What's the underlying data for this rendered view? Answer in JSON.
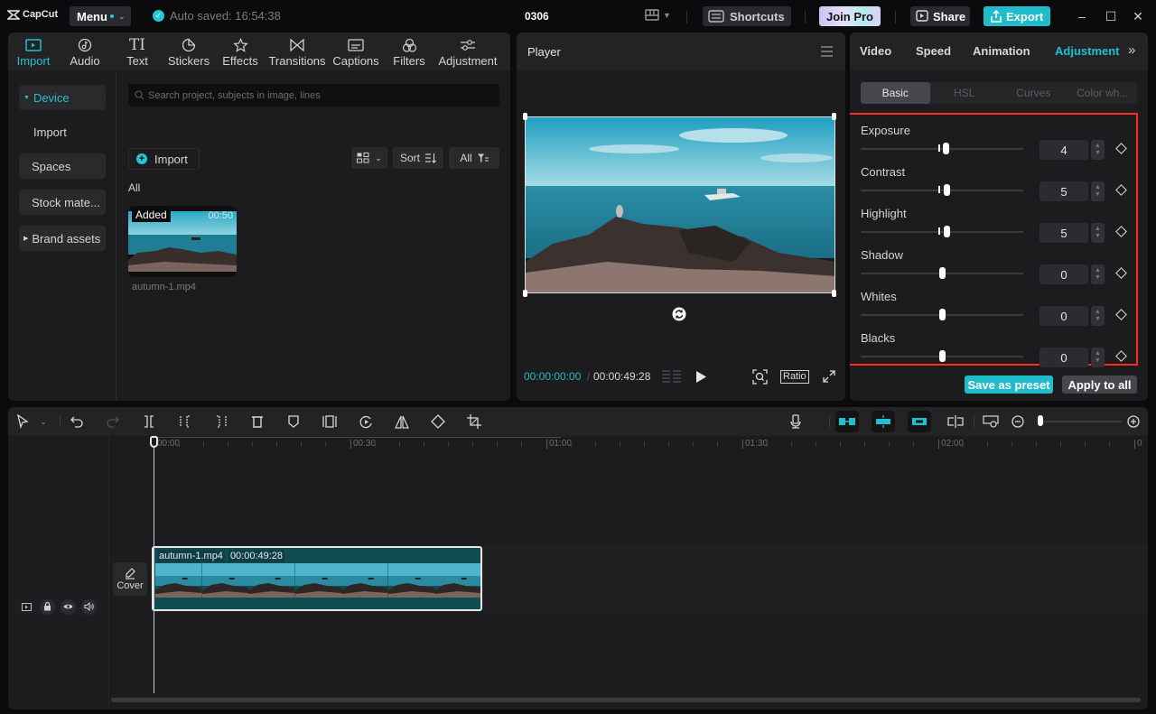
{
  "app": {
    "logo": "CapCut",
    "menu_label": "Menu",
    "autosave": "Auto saved: 16:54:38",
    "project_name": "0306",
    "shortcuts_label": "Shortcuts",
    "join_pro_label": "Join Pro",
    "share_label": "Share",
    "export_label": "Export",
    "accent_color": "#22c0cf"
  },
  "media": {
    "tabs": [
      {
        "label": "Import",
        "icon": "import-icon",
        "active": true
      },
      {
        "label": "Audio",
        "icon": "audio-icon"
      },
      {
        "label": "Text",
        "icon": "text-icon"
      },
      {
        "label": "Stickers",
        "icon": "stickers-icon"
      },
      {
        "label": "Effects",
        "icon": "effects-icon"
      },
      {
        "label": "Transitions",
        "icon": "transitions-icon"
      },
      {
        "label": "Captions",
        "icon": "captions-icon"
      },
      {
        "label": "Filters",
        "icon": "filters-icon"
      },
      {
        "label": "Adjustment",
        "icon": "adjustment-icon"
      }
    ],
    "sidebar": [
      {
        "label": "Device",
        "active": true,
        "expanded": true
      },
      {
        "label": "Import"
      },
      {
        "label": "Spaces"
      },
      {
        "label": "Stock mate..."
      },
      {
        "label": "Brand assets",
        "collapsed": true
      }
    ],
    "search_placeholder": "Search project, subjects in image, lines",
    "import_button": "Import",
    "sort_label": "Sort",
    "filter_label": "All",
    "section_label": "All",
    "items": [
      {
        "name": "autumn-1.mp4",
        "badge": "Added",
        "duration": "00:50"
      }
    ]
  },
  "player": {
    "title": "Player",
    "current_time": "00:00:00:00",
    "separator": "/",
    "total_time": "00:00:49:28",
    "ratio_label": "Ratio"
  },
  "properties": {
    "tabs": [
      "Video",
      "Speed",
      "Animation",
      "Adjustment"
    ],
    "active_tab": "Adjustment",
    "sub_tabs": [
      "Basic",
      "HSL",
      "Curves",
      "Color wh..."
    ],
    "active_sub_tab": "Basic",
    "adjustments": [
      {
        "label": "Exposure",
        "value": "4",
        "fraction": 0.52
      },
      {
        "label": "Contrast",
        "value": "5",
        "fraction": 0.525
      },
      {
        "label": "Highlight",
        "value": "5",
        "fraction": 0.525
      },
      {
        "label": "Shadow",
        "value": "0",
        "fraction": 0.5
      },
      {
        "label": "Whites",
        "value": "0",
        "fraction": 0.5
      },
      {
        "label": "Blacks",
        "value": "0",
        "fraction": 0.5
      }
    ],
    "save_preset_label": "Save as preset",
    "apply_all_label": "Apply to all",
    "highlight_color": "#ff2a1f"
  },
  "timeline": {
    "ruler_labels": [
      "00:00",
      "00:30",
      "01:00",
      "01:30",
      "02:00",
      "0"
    ],
    "cover_label": "Cover",
    "clip": {
      "name": "autumn-1.mp4",
      "duration": "00:00:49:28"
    },
    "zoom_fraction": 0.05
  }
}
